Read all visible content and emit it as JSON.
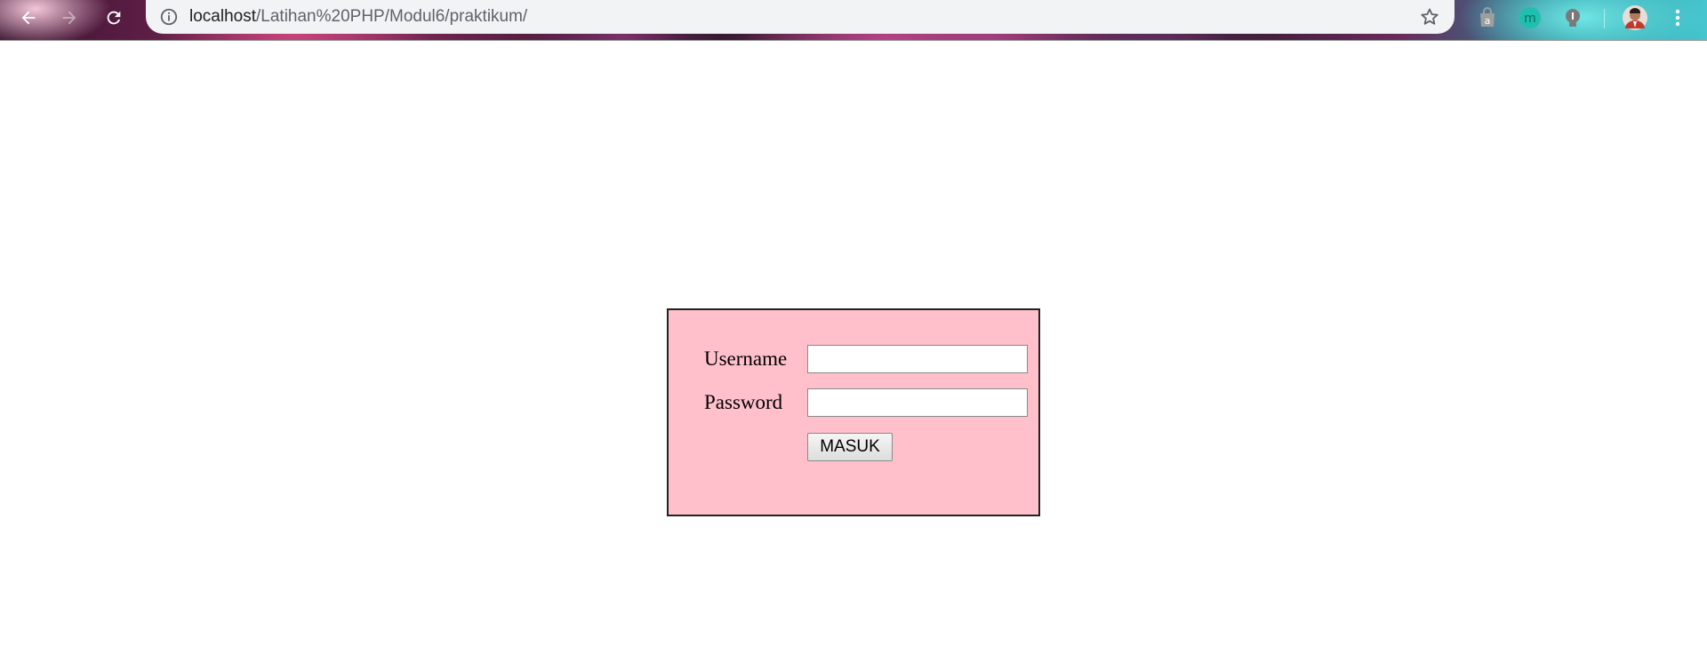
{
  "browser": {
    "url_host": "localhost",
    "url_path": "/Latihan%20PHP/Modul6/praktikum/",
    "extensions": [
      {
        "name": "amazon-assistant",
        "letter": "a"
      },
      {
        "name": "mendeley",
        "letter": "m"
      },
      {
        "name": "bulb",
        "letter": ""
      }
    ]
  },
  "login_form": {
    "username_label": "Username",
    "username_value": "",
    "password_label": "Password",
    "password_value": "",
    "submit_label": "MASUK",
    "background_color": "#ffc0cb"
  },
  "icons": {
    "back": "arrow-left-icon",
    "forward": "arrow-right-icon",
    "reload": "reload-icon",
    "site_info": "info-icon",
    "bookmark": "star-icon",
    "menu": "kebab-menu-icon",
    "profile": "avatar"
  }
}
